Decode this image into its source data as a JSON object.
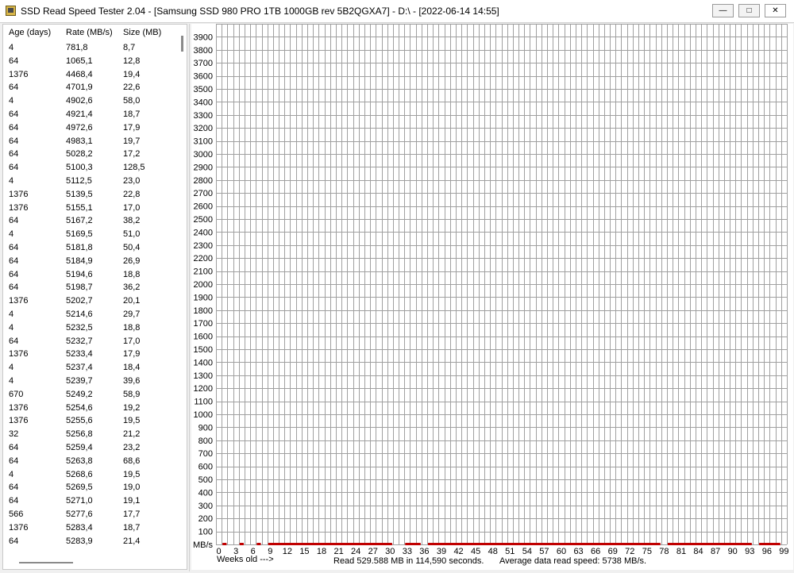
{
  "window": {
    "title": "SSD Read Speed Tester 2.04 - [Samsung SSD 980 PRO 1TB 1000GB rev 5B2QGXA7] - D:\\ - [2022-06-14 14:55]",
    "min_glyph": "—",
    "max_glyph": "□",
    "close_glyph": "✕"
  },
  "table": {
    "columns": [
      "Age (days)",
      "Rate (MB/s)",
      "Size (MB)"
    ],
    "rows": [
      [
        "4",
        "781,8",
        "8,7"
      ],
      [
        "64",
        "1065,1",
        "12,8"
      ],
      [
        "1376",
        "4468,4",
        "19,4"
      ],
      [
        "64",
        "4701,9",
        "22,6"
      ],
      [
        "4",
        "4902,6",
        "58,0"
      ],
      [
        "64",
        "4921,4",
        "18,7"
      ],
      [
        "64",
        "4972,6",
        "17,9"
      ],
      [
        "64",
        "4983,1",
        "19,7"
      ],
      [
        "64",
        "5028,2",
        "17,2"
      ],
      [
        "64",
        "5100,3",
        "128,5"
      ],
      [
        "4",
        "5112,5",
        "23,0"
      ],
      [
        "1376",
        "5139,5",
        "22,8"
      ],
      [
        "1376",
        "5155,1",
        "17,0"
      ],
      [
        "64",
        "5167,2",
        "38,2"
      ],
      [
        "4",
        "5169,5",
        "51,0"
      ],
      [
        "64",
        "5181,8",
        "50,4"
      ],
      [
        "64",
        "5184,9",
        "26,9"
      ],
      [
        "64",
        "5194,6",
        "18,8"
      ],
      [
        "64",
        "5198,7",
        "36,2"
      ],
      [
        "1376",
        "5202,7",
        "20,1"
      ],
      [
        "4",
        "5214,6",
        "29,7"
      ],
      [
        "4",
        "5232,5",
        "18,8"
      ],
      [
        "64",
        "5232,7",
        "17,0"
      ],
      [
        "1376",
        "5233,4",
        "17,9"
      ],
      [
        "4",
        "5237,4",
        "18,4"
      ],
      [
        "4",
        "5239,7",
        "39,6"
      ],
      [
        "670",
        "5249,2",
        "58,9"
      ],
      [
        "1376",
        "5254,6",
        "19,2"
      ],
      [
        "1376",
        "5255,6",
        "19,5"
      ],
      [
        "32",
        "5256,8",
        "21,2"
      ],
      [
        "64",
        "5259,4",
        "23,2"
      ],
      [
        "64",
        "5263,8",
        "68,6"
      ],
      [
        "4",
        "5268,6",
        "19,5"
      ],
      [
        "64",
        "5269,5",
        "19,0"
      ],
      [
        "64",
        "5271,0",
        "19,1"
      ],
      [
        "566",
        "5277,6",
        "17,7"
      ],
      [
        "1376",
        "5283,4",
        "18,7"
      ],
      [
        "64",
        "5283,9",
        "21,4"
      ]
    ]
  },
  "chart_data": {
    "type": "bar",
    "ylabel": "MB/s",
    "xlabel": "Weeks old --->",
    "ylim": [
      0,
      4000
    ],
    "y_ticks": [
      100,
      200,
      300,
      400,
      500,
      600,
      700,
      800,
      900,
      1000,
      1100,
      1200,
      1300,
      1400,
      1500,
      1600,
      1700,
      1800,
      1900,
      2000,
      2100,
      2200,
      2300,
      2400,
      2500,
      2600,
      2700,
      2800,
      2900,
      3000,
      3100,
      3200,
      3300,
      3400,
      3500,
      3600,
      3700,
      3800,
      3900
    ],
    "x_ticks": [
      "0",
      "3",
      "6",
      "9",
      "12",
      "15",
      "18",
      "21",
      "24",
      "27",
      "30",
      "33",
      "36",
      "39",
      "42",
      "45",
      "48",
      "51",
      "54",
      "57",
      "60",
      "63",
      "66",
      "69",
      "72",
      "75",
      "78",
      "81",
      "84",
      "87",
      "90",
      "93",
      "96",
      "99"
    ],
    "weeks": 100,
    "bar_color": "#c00000",
    "present_week_ranges": [
      [
        1,
        1
      ],
      [
        4,
        4
      ],
      [
        7,
        7
      ],
      [
        9,
        30
      ],
      [
        33,
        35
      ],
      [
        37,
        77
      ],
      [
        79,
        93
      ],
      [
        95,
        98
      ]
    ]
  },
  "footer": {
    "read_summary": "Read 529.588 MB in 114,590 seconds.",
    "average": "Average data read speed: 5738 MB/s."
  }
}
